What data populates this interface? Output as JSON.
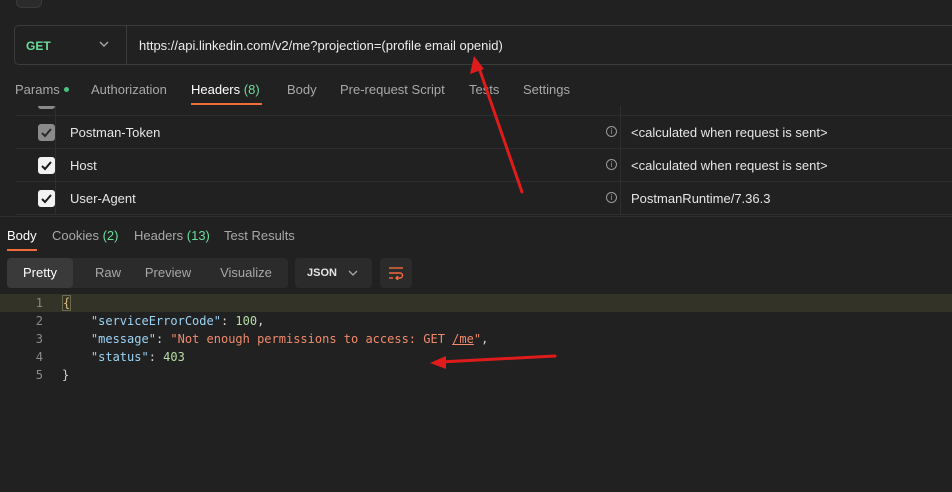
{
  "request": {
    "method": "GET",
    "url": "https://api.linkedin.com/v2/me?projection=(profile email openid)"
  },
  "request_tabs": [
    {
      "label": "Params",
      "count": ""
    },
    {
      "label": "Authorization",
      "count": ""
    },
    {
      "label": "Headers",
      "count": "(8)"
    },
    {
      "label": "Body",
      "count": ""
    },
    {
      "label": "Pre-request Script",
      "count": ""
    },
    {
      "label": "Tests",
      "count": ""
    },
    {
      "label": "Settings",
      "count": ""
    }
  ],
  "headers": [
    {
      "key": "Postman-Token",
      "value": "<calculated when request is sent>",
      "checked": true
    },
    {
      "key": "Host",
      "value": "<calculated when request is sent>",
      "checked": true
    },
    {
      "key": "User-Agent",
      "value": "PostmanRuntime/7.36.3",
      "checked": true
    }
  ],
  "response_tabs": [
    {
      "label": "Body",
      "count": ""
    },
    {
      "label": "Cookies",
      "count": "(2)"
    },
    {
      "label": "Headers",
      "count": "(13)"
    },
    {
      "label": "Test Results",
      "count": ""
    }
  ],
  "view_modes": [
    "Pretty",
    "Raw",
    "Preview",
    "Visualize"
  ],
  "format": "JSON",
  "response_body": {
    "line_numbers": [
      "1",
      "2",
      "3",
      "4",
      "5"
    ],
    "open_brace": "{",
    "close_brace": "}",
    "k1": "\"serviceErrorCode\"",
    "v1": "100",
    "k2": "\"message\"",
    "v2_prefix": "\"Not enough permissions to access: GET ",
    "v2_link": "/me",
    "v2_suffix": "\"",
    "k3": "\"status\"",
    "v3": "403"
  },
  "colors": {
    "accent": "#f26b3a",
    "method": "#6bdd9a",
    "annotation_arrow": "#e01b1b"
  }
}
